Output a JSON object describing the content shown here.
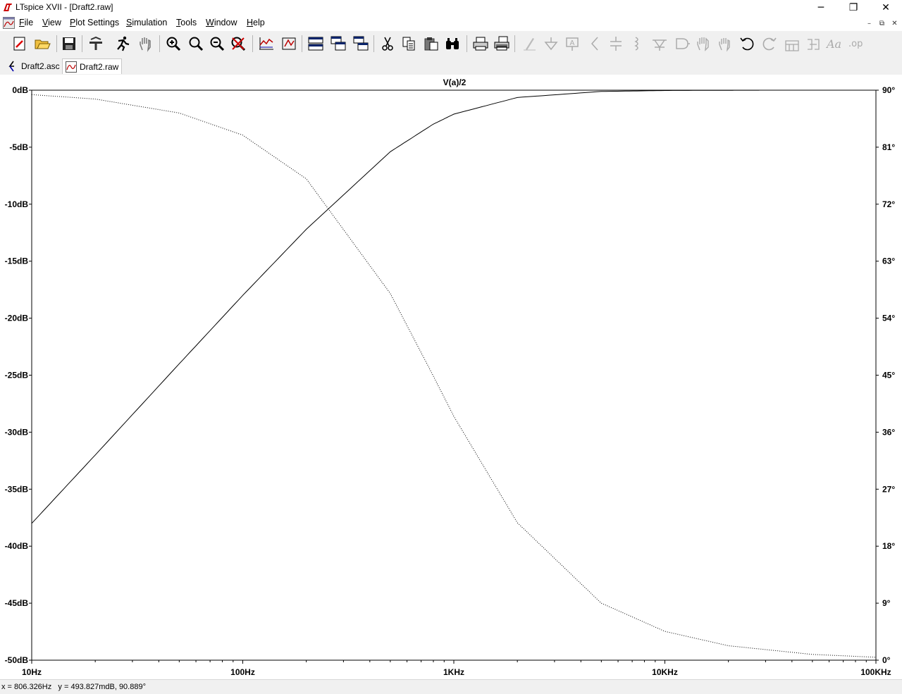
{
  "window": {
    "title": "LTspice XVII - [Draft2.raw]",
    "minimize_glyph": "─",
    "maximize_glyph": "❐",
    "close_glyph": "✕"
  },
  "menu": [
    "File",
    "View",
    "Plot Settings",
    "Simulation",
    "Tools",
    "Window",
    "Help"
  ],
  "mdi_controls": [
    "–",
    "⧉",
    "✕"
  ],
  "toolbar": [
    {
      "name": "new-schematic-icon"
    },
    {
      "name": "open-icon"
    },
    {
      "name": "save-icon"
    },
    {
      "name": "control-panel-icon"
    },
    {
      "name": "run-icon"
    },
    {
      "name": "pan-icon"
    },
    {
      "name": "zoom-in-icon"
    },
    {
      "name": "zoom-extents-icon"
    },
    {
      "name": "zoom-out-icon"
    },
    {
      "name": "zoom-cancel-icon"
    },
    {
      "name": "autorange-icon"
    },
    {
      "name": "manual-limits-icon"
    },
    {
      "name": "tile-horizontal-icon"
    },
    {
      "name": "cascade-icon"
    },
    {
      "name": "tile-vertical-icon"
    },
    {
      "name": "cut-icon"
    },
    {
      "name": "copy-icon"
    },
    {
      "name": "paste-icon"
    },
    {
      "name": "find-icon"
    },
    {
      "name": "print-icon"
    },
    {
      "name": "print-preview-icon"
    },
    {
      "name": "wire-icon"
    },
    {
      "name": "ground-icon"
    },
    {
      "name": "label-icon"
    },
    {
      "name": "resistor-icon"
    },
    {
      "name": "capacitor-icon"
    },
    {
      "name": "inductor-icon"
    },
    {
      "name": "diode-icon"
    },
    {
      "name": "component-icon"
    },
    {
      "name": "move-icon"
    },
    {
      "name": "drag-icon"
    },
    {
      "name": "undo-icon"
    },
    {
      "name": "redo-icon"
    },
    {
      "name": "rotate-icon"
    },
    {
      "name": "mirror-icon"
    },
    {
      "name": "text-icon"
    },
    {
      "name": "spice-directive-icon"
    }
  ],
  "tabs": [
    {
      "label": "Draft2.asc",
      "active": false
    },
    {
      "label": "Draft2.raw",
      "active": true
    }
  ],
  "plot": {
    "title": "V(a)/2",
    "left_ticks": [
      "0dB",
      "-5dB",
      "-10dB",
      "-15dB",
      "-20dB",
      "-25dB",
      "-30dB",
      "-35dB",
      "-40dB",
      "-45dB",
      "-50dB"
    ],
    "right_ticks": [
      "90°",
      "81°",
      "72°",
      "63°",
      "54°",
      "45°",
      "36°",
      "27°",
      "18°",
      "9°",
      "0°"
    ],
    "x_ticks": [
      "10Hz",
      "100Hz",
      "1KHz",
      "10KHz",
      "100KHz"
    ]
  },
  "chart_data": {
    "type": "line",
    "title": "V(a)/2",
    "x_scale": "log",
    "xlim": [
      10,
      100000
    ],
    "ylim_left": [
      -50,
      0
    ],
    "ylim_right": [
      0,
      90
    ],
    "left_unit": "dB",
    "right_unit": "°",
    "grid": false,
    "cutoff_hz": 796,
    "series": [
      {
        "style": "solid",
        "axis": "left",
        "x": [
          10,
          20,
          50,
          100,
          200,
          500,
          796,
          1000,
          2000,
          5000,
          10000,
          20000,
          28000
        ],
        "y": [
          -38.0,
          -32.0,
          -24.0,
          -18.0,
          -12.2,
          -5.4,
          -3.0,
          -2.1,
          -0.64,
          -0.11,
          -0.03,
          -0.01,
          -0.005
        ]
      },
      {
        "style": "dotted",
        "axis": "right",
        "x": [
          10,
          20,
          50,
          100,
          200,
          500,
          796,
          1000,
          2000,
          5000,
          10000,
          20000,
          50000,
          100000
        ],
        "y": [
          89.3,
          88.6,
          86.4,
          82.9,
          76.0,
          57.9,
          45.0,
          38.5,
          21.7,
          9.0,
          4.55,
          2.28,
          0.91,
          0.46
        ]
      }
    ]
  },
  "status": {
    "text": "x = 806.326Hz   y = 493.827mdB, 90.889°"
  }
}
